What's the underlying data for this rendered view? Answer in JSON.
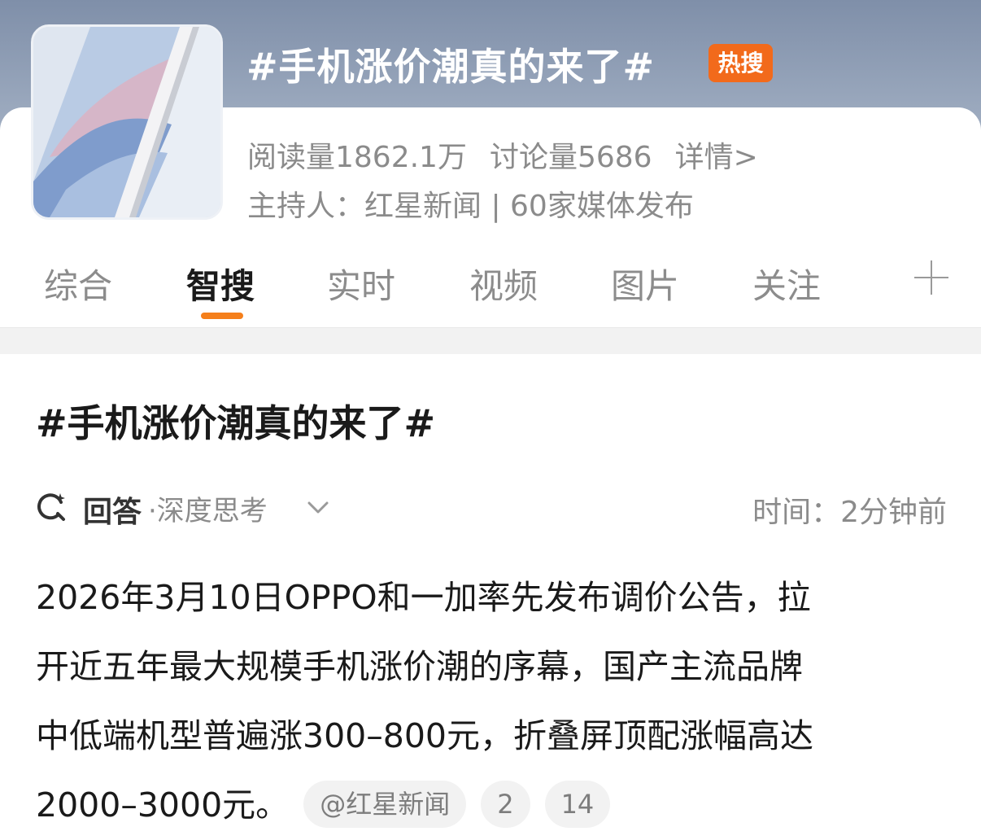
{
  "topic": {
    "title": "#手机涨价潮真的来了#",
    "badge": "热搜",
    "reads": "阅读量1862.1万",
    "discussions": "讨论量5686",
    "detail_link": "详情>",
    "host_line": "主持人：红星新闻 | 60家媒体发布"
  },
  "tabs": [
    {
      "label": "综合",
      "active": false
    },
    {
      "label": "智搜",
      "active": true
    },
    {
      "label": "实时",
      "active": false
    },
    {
      "label": "视频",
      "active": false
    },
    {
      "label": "图片",
      "active": false
    },
    {
      "label": "关注",
      "active": false
    }
  ],
  "result": {
    "title": "#手机涨价潮真的来了#",
    "answer_label": "回答",
    "answer_mode": "·深度思考",
    "time": "时间：2分钟前",
    "body_lines": [
      "2026年3月10日OPPO和一加率先发布调价公告，拉",
      "开近五年最大规模手机涨价潮的序幕，国产主流品牌",
      "中低端机型普遍涨300–800元，折叠屏顶配涨幅高达",
      "2000–3000元。"
    ],
    "source_pill": "@红星新闻",
    "ref_pills": [
      "2",
      "14"
    ]
  },
  "icons": {
    "thumb": "phone-wallpaper-thumbnail",
    "answer": "spark-search-icon",
    "expand": "chevron-down-icon",
    "add_tab": "plus-icon"
  },
  "colors": {
    "accent": "#f57f1b",
    "badge": "#f26a1b"
  }
}
